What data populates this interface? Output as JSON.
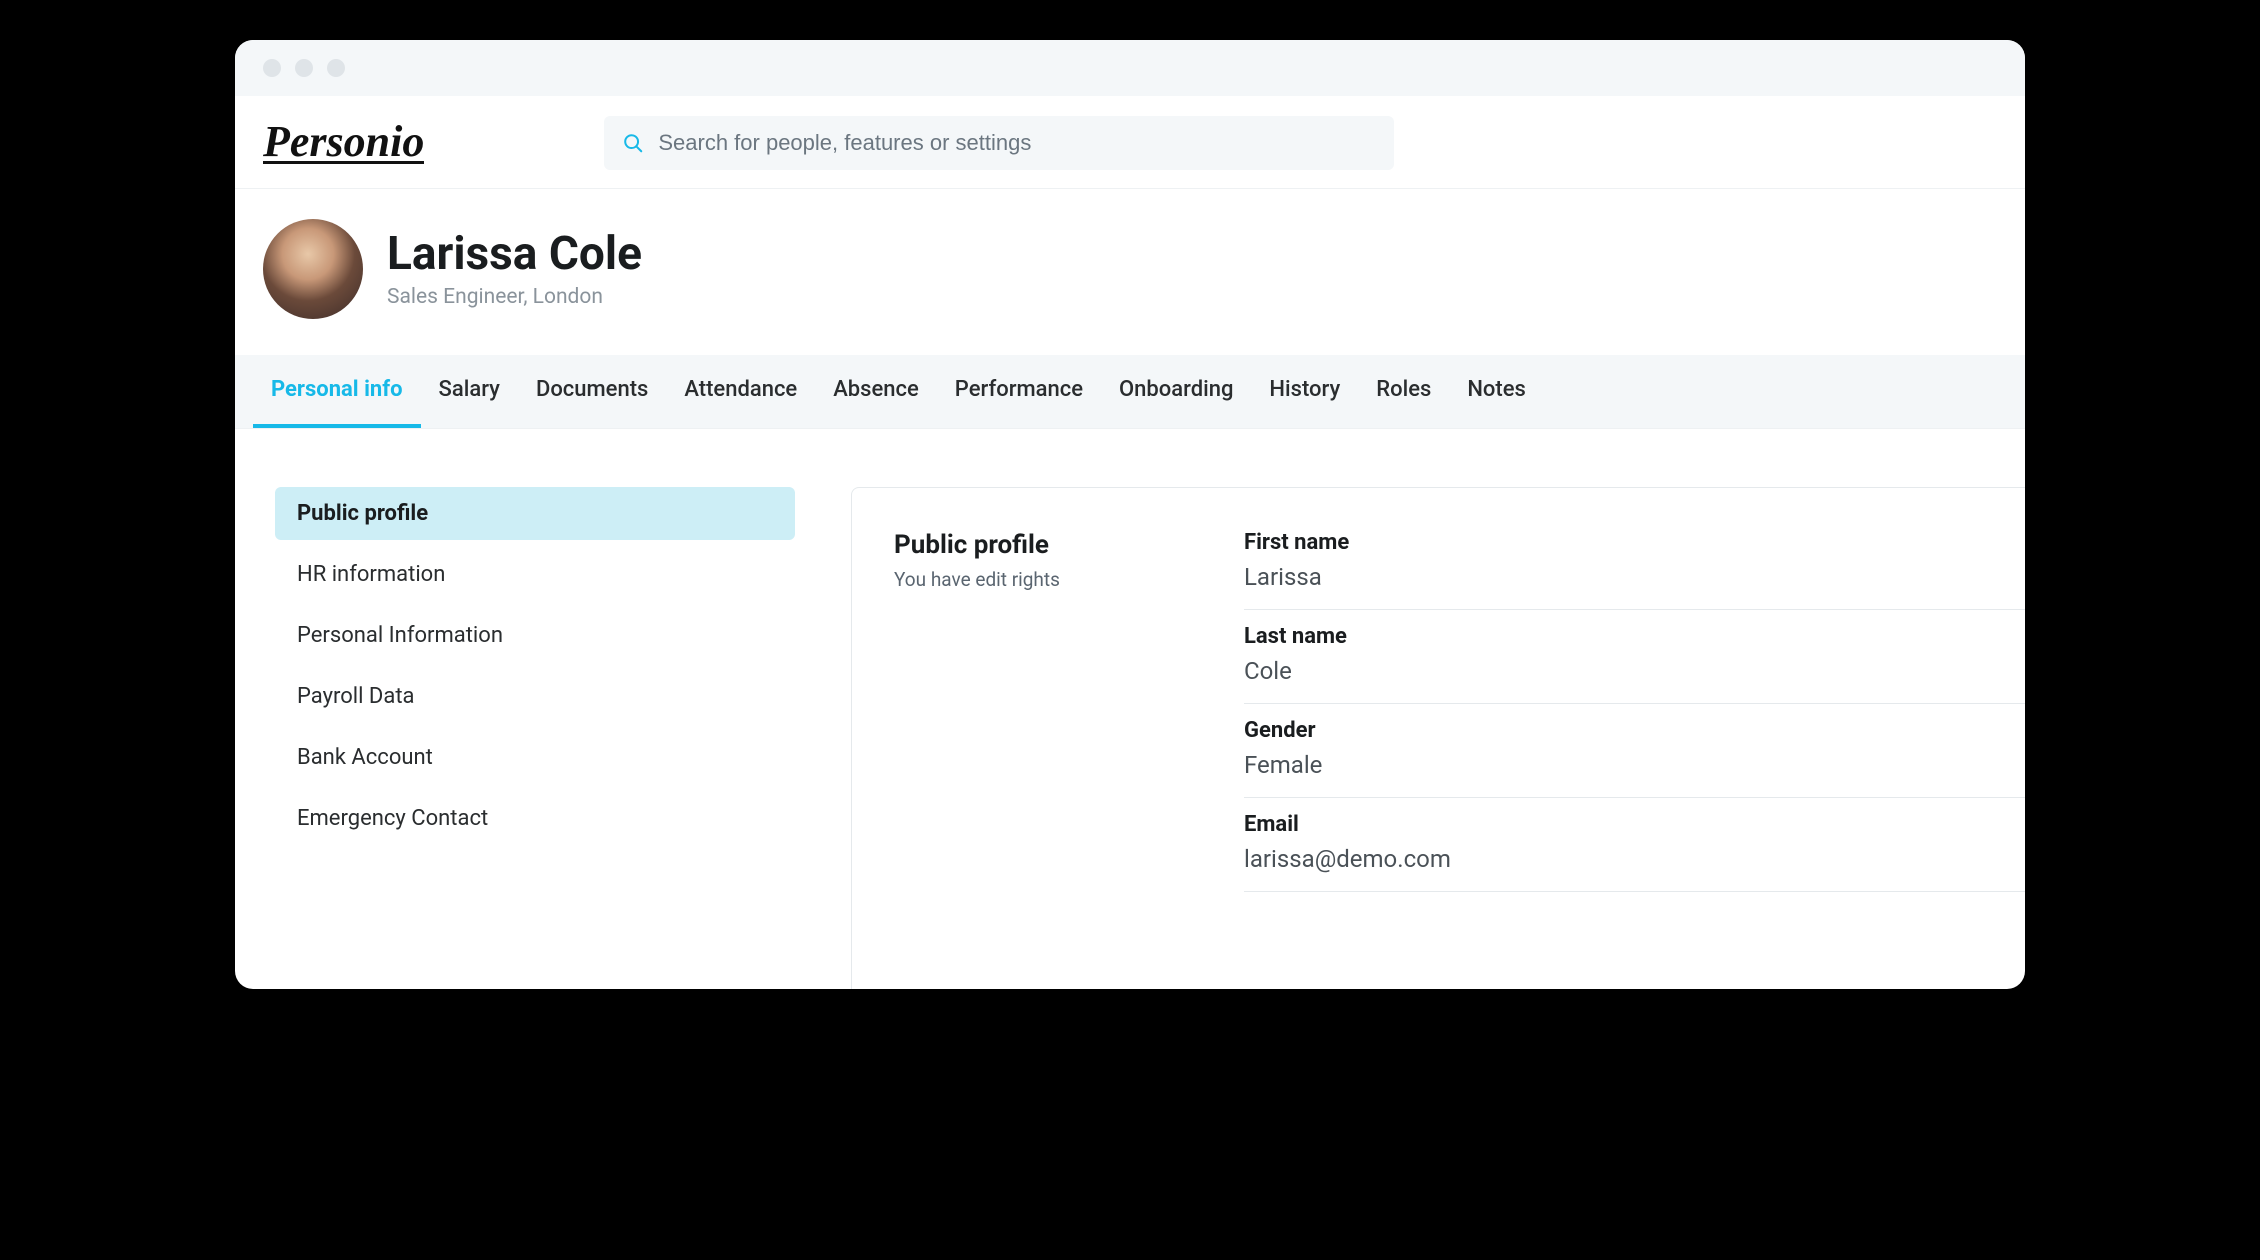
{
  "logo_text": "Personio",
  "search": {
    "placeholder": "Search for people, features or settings"
  },
  "profile": {
    "name": "Larissa Cole",
    "subtitle": "Sales Engineer, London"
  },
  "tabs": [
    {
      "label": "Personal info",
      "active": true
    },
    {
      "label": "Salary",
      "active": false
    },
    {
      "label": "Documents",
      "active": false
    },
    {
      "label": "Attendance",
      "active": false
    },
    {
      "label": "Absence",
      "active": false
    },
    {
      "label": "Performance",
      "active": false
    },
    {
      "label": "Onboarding",
      "active": false
    },
    {
      "label": "History",
      "active": false
    },
    {
      "label": "Roles",
      "active": false
    },
    {
      "label": "Notes",
      "active": false
    }
  ],
  "sidebar": {
    "items": [
      {
        "label": "Public profile",
        "active": true
      },
      {
        "label": "HR information",
        "active": false
      },
      {
        "label": "Personal Information",
        "active": false
      },
      {
        "label": "Payroll Data",
        "active": false
      },
      {
        "label": "Bank Account",
        "active": false
      },
      {
        "label": "Emergency Contact",
        "active": false
      }
    ]
  },
  "panel": {
    "title": "Public profile",
    "subtitle": "You have edit rights",
    "fields": [
      {
        "label": "First name",
        "value": "Larissa"
      },
      {
        "label": "Last name",
        "value": "Cole"
      },
      {
        "label": "Gender",
        "value": "Female"
      },
      {
        "label": "Email",
        "value": "larissa@demo.com"
      }
    ]
  }
}
